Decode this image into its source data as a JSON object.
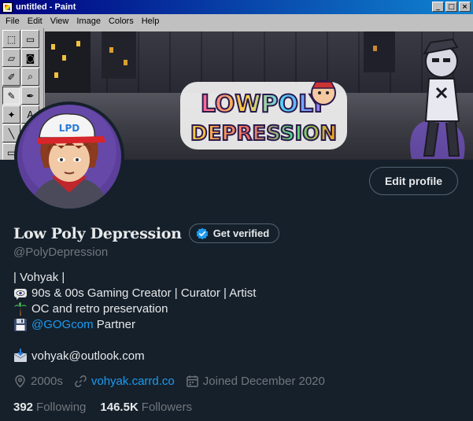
{
  "paint": {
    "title": "untitled - Paint",
    "window_buttons": [
      "_",
      "□",
      "×"
    ],
    "menu": [
      "File",
      "Edit",
      "View",
      "Image",
      "Colors",
      "Help"
    ],
    "tools": [
      {
        "name": "free-select-icon",
        "glyph": "⬚"
      },
      {
        "name": "select-icon",
        "glyph": "▭"
      },
      {
        "name": "eraser-icon",
        "glyph": "▱"
      },
      {
        "name": "fill-icon",
        "glyph": "◙"
      },
      {
        "name": "color-picker-icon",
        "glyph": "✐"
      },
      {
        "name": "magnifier-icon",
        "glyph": "⌕"
      },
      {
        "name": "pencil-icon",
        "glyph": "✎"
      },
      {
        "name": "brush-icon",
        "glyph": "✒"
      },
      {
        "name": "airbrush-icon",
        "glyph": "✦"
      },
      {
        "name": "text-tool-icon",
        "glyph": "A"
      },
      {
        "name": "line-tool-icon",
        "glyph": "╲"
      },
      {
        "name": "curve-tool-icon",
        "glyph": "∿"
      },
      {
        "name": "rectangle-tool-icon",
        "glyph": "▭"
      }
    ],
    "graffiti_text": [
      "LOWPOLY",
      "DEPRESSION"
    ],
    "cap_text": "LPD"
  },
  "profile": {
    "edit_button": "Edit profile",
    "display_name": "Low Poly Depression",
    "verify_label": "Get verified",
    "handle": "@PolyDepression",
    "bio": {
      "line1": "| Vohyak |",
      "line2": "90s & 00s Gaming Creator | Curator | Artist",
      "line3": "OC and retro preservation",
      "line4_link": "@GOGcom",
      "line4_rest": " Partner"
    },
    "email": "vohyak@outlook.com",
    "location": "2000s",
    "website": "vohyak.carrd.co",
    "joined": "Joined December 2020",
    "following_count": "392",
    "following_label": "Following",
    "followers_count": "146.5K",
    "followers_label": "Followers"
  },
  "colors": {
    "background": "#15202b",
    "text": "#e7e9ea",
    "muted": "#71767b",
    "accent": "#1d9bf0",
    "border": "#536471",
    "win_title": "#000080",
    "win_face": "#c0c0c0"
  }
}
